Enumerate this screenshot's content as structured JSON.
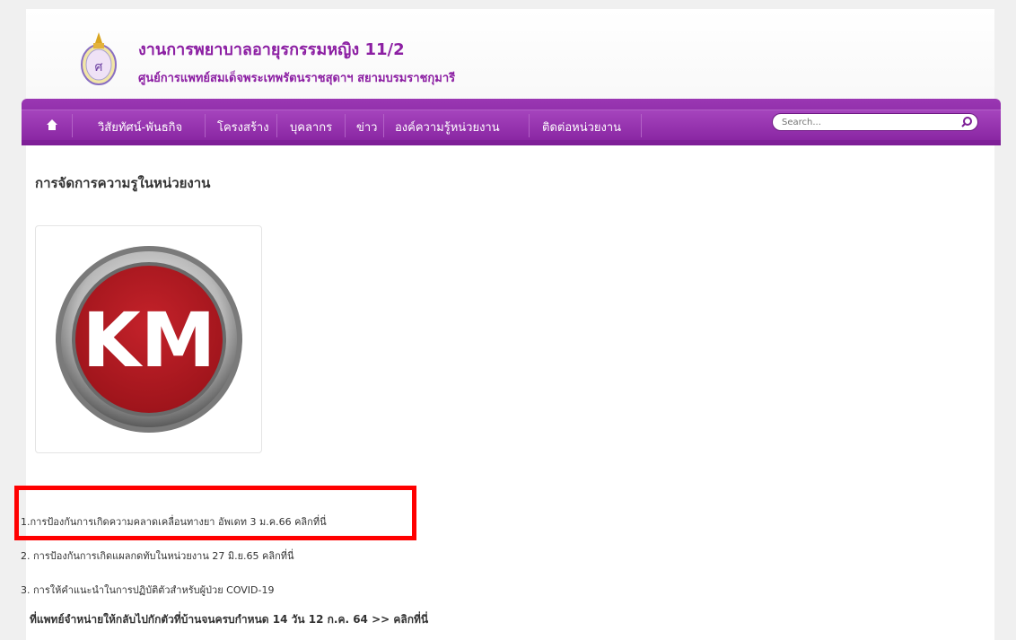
{
  "header": {
    "title": "งานการพยาบาลอายุรกรรมหญิง 11/2",
    "subtitle": "ศูนย์การแพทย์สมเด็จพระเทพรัตนราชสุดาฯ สยามบรมราชกุมารี"
  },
  "nav": {
    "items": [
      {
        "label": "วิสัยทัศน์-พันธกิจ"
      },
      {
        "label": "โครงสร้าง"
      },
      {
        "label": "บุคลากร"
      },
      {
        "label": "ข่าว"
      },
      {
        "label": "องค์ความรู้หน่วยงาน"
      },
      {
        "label": "ติดต่อหน่วยงาน"
      }
    ],
    "search_placeholder": "Search..."
  },
  "content": {
    "heading": "การจัดการความรูในหน่วยงาน",
    "logo_text": "KM",
    "items": [
      {
        "text": "1.การป้องกันการเกิดความคลาดเคลื่อนทางยา  อัพเดท 3 ม.ค.66 ",
        "link": "คลิกที่นี่"
      },
      {
        "text": "2. การป้องกันการเกิดแผลกดทับในหน่วยงาน  27 มิ.ย.65 ",
        "link": "คลิกที่นี่"
      },
      {
        "text": "3. การให้คำแนะนำในการปฏิบัติตัวสำหรับผู้ป่วย COVID-19"
      },
      {
        "text": "ที่แพทย์จำหน่ายให้กลับไปกักตัวที่บ้านจนครบกำหนด 14 วัน 12 ก.ค. 64 >> ",
        "link": "คลิกที่นี่"
      }
    ]
  },
  "colors": {
    "accent": "#8c1fa3",
    "nav": "#8a27a3",
    "highlight": "#ff0000"
  }
}
